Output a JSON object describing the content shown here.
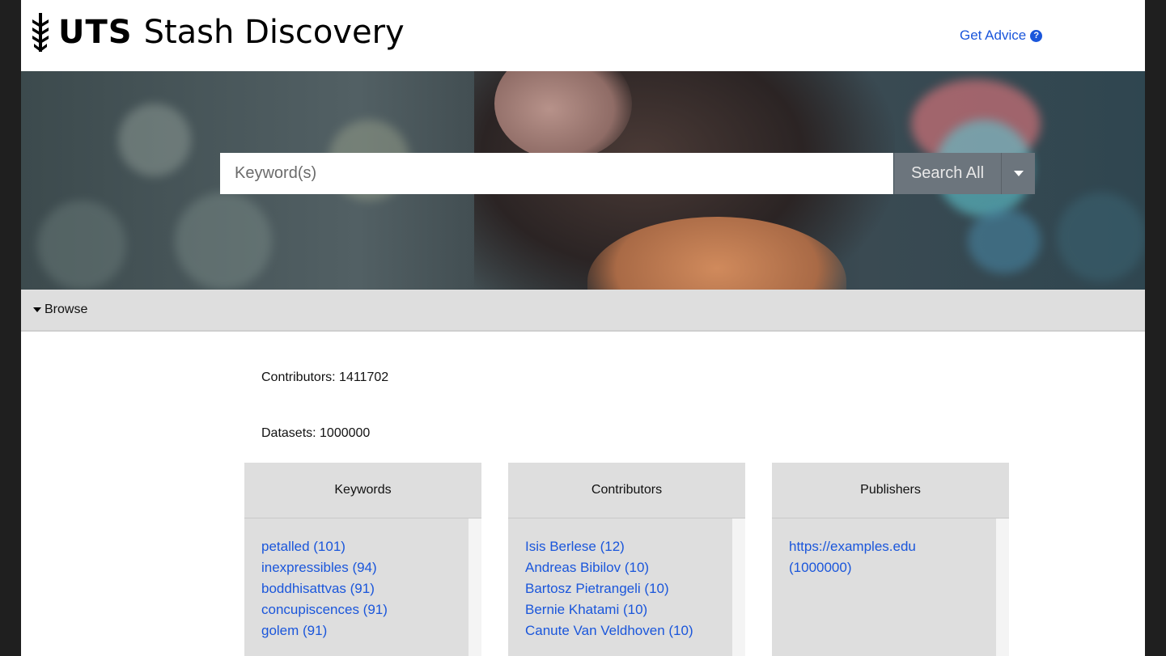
{
  "header": {
    "brand_bold": "UTS",
    "brand_text": "Stash Discovery",
    "advice_label": "Get Advice",
    "advice_icon": "question-circle-icon"
  },
  "search": {
    "placeholder": "Keyword(s)",
    "button_label": "Search All",
    "dropdown_icon": "caret-down-icon"
  },
  "browse": {
    "label": "Browse",
    "contributors_stat": "Contributors: 1411702",
    "datasets_stat": "Datasets: 1000000"
  },
  "columns": {
    "keywords": {
      "title": "Keywords",
      "items": [
        "petalled (101)",
        "inexpressibles (94)",
        "boddhisattvas (91)",
        "concupiscences (91)",
        "golem (91)"
      ]
    },
    "contributors": {
      "title": "Contributors",
      "items": [
        "Isis Berlese (12)",
        "Andreas Bibilov (10)",
        "Bartosz Pietrangeli (10)",
        "Bernie Khatami (10)",
        "Canute Van Veldhoven (10)"
      ]
    },
    "publishers": {
      "title": "Publishers",
      "items": [
        "https://examples.edu (1000000)"
      ]
    }
  },
  "colors": {
    "link": "#1a56db",
    "search_button": "#6c757d",
    "browse_bar": "#dedede"
  }
}
